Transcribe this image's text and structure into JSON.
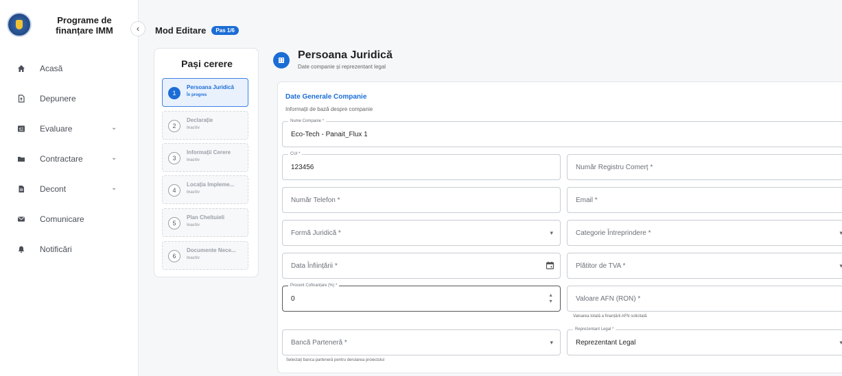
{
  "sidebar": {
    "brand_title": "Programe de finanțare IMM",
    "items": [
      {
        "label": "Acasă",
        "icon": "home-icon",
        "expandable": false
      },
      {
        "label": "Depunere",
        "icon": "file-upload-icon",
        "expandable": false
      },
      {
        "label": "Evaluare",
        "icon": "checklist-icon",
        "expandable": true
      },
      {
        "label": "Contractare",
        "icon": "folder-icon",
        "expandable": true
      },
      {
        "label": "Decont",
        "icon": "document-icon",
        "expandable": true
      },
      {
        "label": "Comunicare",
        "icon": "mail-icon",
        "expandable": false
      },
      {
        "label": "Notificări",
        "icon": "bell-icon",
        "expandable": false
      }
    ]
  },
  "header": {
    "mode_title": "Mod Editare",
    "step_badge": "Pas 1/6"
  },
  "steps": {
    "title": "Pași cerere",
    "items": [
      {
        "num": "1",
        "label": "Persoana Juridică",
        "status": "În progres",
        "active": true
      },
      {
        "num": "2",
        "label": "Declarație",
        "status": "Inactiv",
        "active": false
      },
      {
        "num": "3",
        "label": "Informații Cerere",
        "status": "Inactiv",
        "active": false
      },
      {
        "num": "4",
        "label": "Locația Impleme...",
        "status": "Inactiv",
        "active": false
      },
      {
        "num": "5",
        "label": "Plan Cheltuieli",
        "status": "Inactiv",
        "active": false
      },
      {
        "num": "6",
        "label": "Documente Nece...",
        "status": "Inactiv",
        "active": false
      }
    ]
  },
  "main": {
    "title": "Persoana Juridică",
    "subtitle": "Date companie și reprezentant legal",
    "section_title": "Date Generale Companie",
    "section_subtitle": "Informații de bază despre companie"
  },
  "form": {
    "nume_companie": {
      "label": "Nume Companie *",
      "value": "Eco-Tech - Panait_Flux 1"
    },
    "cui": {
      "label": "CUI *",
      "value": "123456"
    },
    "numar_registru": {
      "placeholder": "Număr Registru Comerț *"
    },
    "numar_telefon": {
      "placeholder": "Număr Telefon *"
    },
    "email": {
      "placeholder": "Email *"
    },
    "forma_juridica": {
      "placeholder": "Formă Juridică *"
    },
    "categorie": {
      "placeholder": "Categorie Întreprindere *"
    },
    "data_infiintarii": {
      "placeholder": "Data Înființării *"
    },
    "platitor_tva": {
      "placeholder": "Plătitor de TVA *"
    },
    "procent": {
      "label": "Procent Cofinanțare (%) *",
      "value": "0"
    },
    "valoare_afn": {
      "placeholder": "Valoare AFN (RON) *",
      "helper": "Valoarea totală a finanțării AFN solicitată"
    },
    "banca": {
      "placeholder": "Bancă Parteneră *",
      "helper": "Selectați banca parteneră pentru derularea proiectului"
    },
    "reprezentant": {
      "label": "Reprezentant Legal *",
      "value": "Reprezentant Legal"
    }
  },
  "colors": {
    "accent": "#1b6dd6",
    "accent_light": "#e9f1fd"
  }
}
